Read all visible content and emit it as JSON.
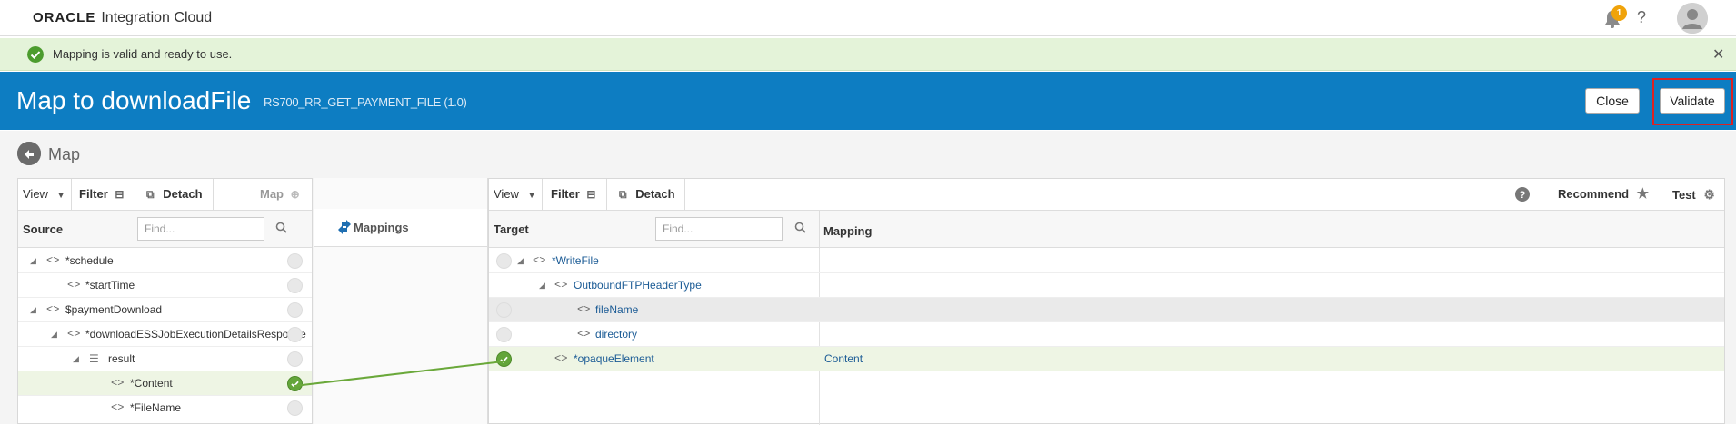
{
  "header": {
    "brand_oracle": "ORACLE",
    "brand_product": "Integration Cloud",
    "notification_count": "1",
    "help_label": "?"
  },
  "message": {
    "text": "Mapping is valid and ready to use.",
    "close_label": "✕",
    "status_color": "#4c9c2e"
  },
  "titlebar": {
    "title": "Map to downloadFile",
    "subtitle": "RS700_RR_GET_PAYMENT_FILE (1.0)",
    "close_label": "Close",
    "validate_label": "Validate",
    "accent": "#0d7dc2"
  },
  "map_section": {
    "title": "Map"
  },
  "source_pane": {
    "toolbar": {
      "view_label": "View",
      "filter_label": "Filter",
      "detach_label": "Detach",
      "map_label": "Map"
    },
    "header_label": "Source",
    "find_placeholder": "Find...",
    "rows": [
      {
        "expander": "◢",
        "label": "*schedule"
      },
      {
        "expander": "",
        "label": "*startTime"
      },
      {
        "expander": "◢",
        "label": "$paymentDownload"
      },
      {
        "expander": "◢",
        "label": "*downloadESSJobExecutionDetailsResponse"
      },
      {
        "expander": "◢",
        "label": "result"
      },
      {
        "expander": "",
        "label": "*Content"
      },
      {
        "expander": "",
        "label": "*FileName"
      }
    ]
  },
  "middle_pane": {
    "label": "Mappings"
  },
  "target_pane": {
    "toolbar": {
      "view_label": "View",
      "filter_label": "Filter",
      "detach_label": "Detach",
      "recommend_label": "Recommend",
      "test_label": "Test"
    },
    "header_label": "Target",
    "find_placeholder": "Find...",
    "mapping_header": "Mapping",
    "rows": [
      {
        "expander": "◢",
        "label": "*WriteFile",
        "mapping": ""
      },
      {
        "expander": "◢",
        "label": "OutboundFTPHeaderType",
        "mapping": ""
      },
      {
        "expander": "",
        "label": "fileName",
        "mapping": ""
      },
      {
        "expander": "",
        "label": "directory",
        "mapping": ""
      },
      {
        "expander": "",
        "label": "*opaqueElement",
        "mapping": "Content"
      }
    ]
  }
}
